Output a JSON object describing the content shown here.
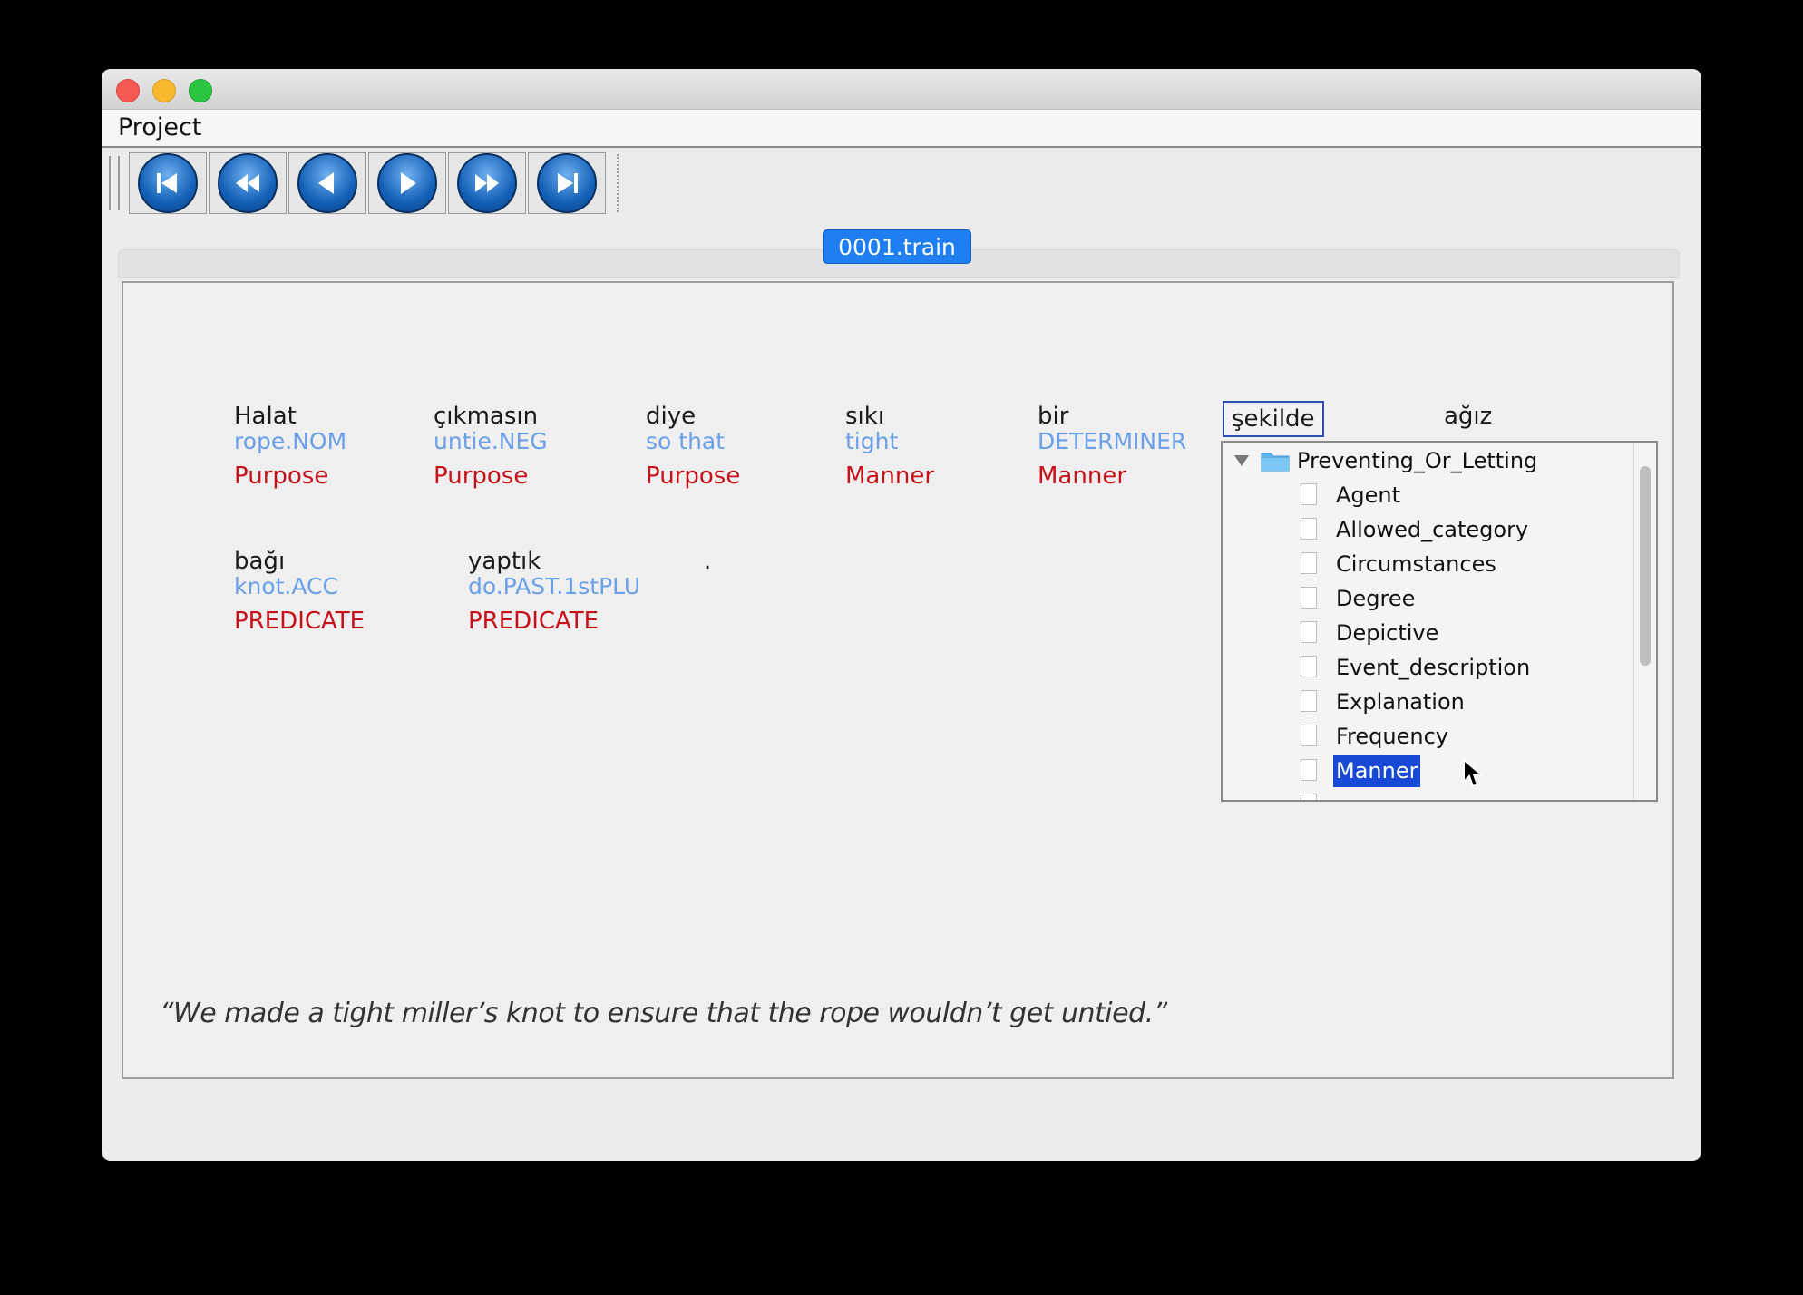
{
  "menu": {
    "project_label": "Project"
  },
  "toolbar": {
    "buttons": [
      "first",
      "fast-backward",
      "backward",
      "forward",
      "fast-forward",
      "last"
    ]
  },
  "tab": {
    "label": "0001.train"
  },
  "words": [
    {
      "word": "Halat",
      "gloss": "rope.NOM",
      "role": "Purpose"
    },
    {
      "word": "çıkmasın",
      "gloss": "untie.NEG",
      "role": "Purpose"
    },
    {
      "word": "diye",
      "gloss": "so that",
      "role": "Purpose"
    },
    {
      "word": "sıkı",
      "gloss": "tight",
      "role": "Manner"
    },
    {
      "word": "bir",
      "gloss": "DETERMINER",
      "role": "Manner"
    },
    {
      "word": "şekilde"
    },
    {
      "word": "ağız"
    },
    {
      "word": "bağı",
      "gloss": "knot.ACC",
      "role": "PREDICATE"
    },
    {
      "word": "yaptık",
      "gloss": "do.PAST.1stPLU",
      "role": "PREDICATE"
    },
    {
      "word": "."
    }
  ],
  "dropdown": {
    "root": "Preventing_Or_Letting",
    "items": [
      "Agent",
      "Allowed_category",
      "Circumstances",
      "Degree",
      "Depictive",
      "Event_description",
      "Explanation",
      "Frequency",
      "Manner"
    ],
    "selected": "Manner"
  },
  "translation": "“We made a tight miller’s knot to ensure that the rope wouldn’t get untied.”",
  "colors": {
    "gloss": "#6aa0e8",
    "role": "#c8101a",
    "tab": "#1f7ef2",
    "selection": "#1849d6"
  }
}
